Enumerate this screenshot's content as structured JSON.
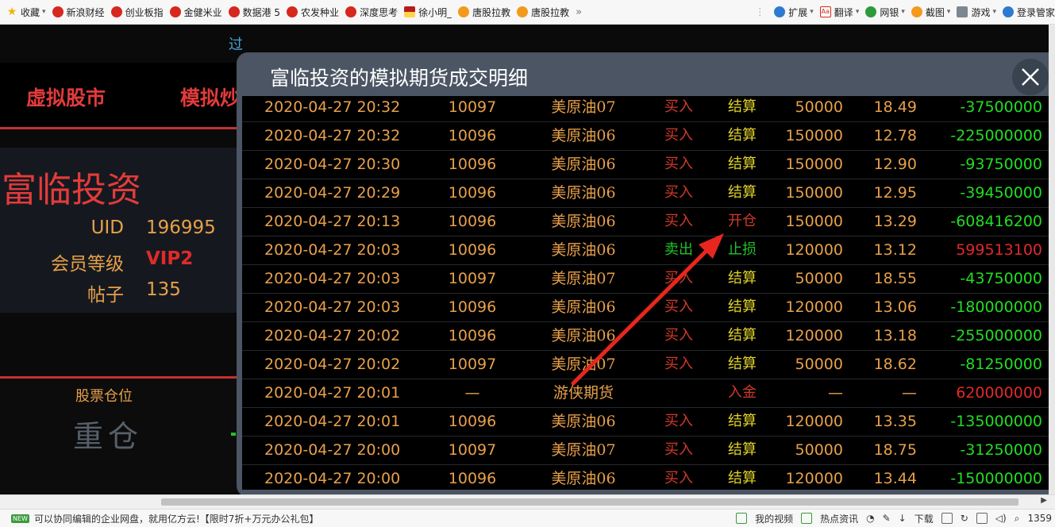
{
  "bookmarks_bar": {
    "items": [
      {
        "label": "收藏",
        "icon": "star-icon"
      },
      {
        "label": "新浪财经",
        "icon": "weibo-icon"
      },
      {
        "label": "创业板指",
        "icon": "weibo-icon"
      },
      {
        "label": "金健米业",
        "icon": "weibo-icon"
      },
      {
        "label": "数据港 5",
        "icon": "weibo-icon"
      },
      {
        "label": "农发种业",
        "icon": "weibo-icon"
      },
      {
        "label": "深度思考",
        "icon": "weibo-icon"
      },
      {
        "label": "徐小明_",
        "icon": "flag-icon"
      },
      {
        "label": "唐股拉教",
        "icon": "orange-icon"
      },
      {
        "label": "唐股拉教",
        "icon": "orange-icon"
      }
    ],
    "more": "»",
    "tools": [
      {
        "label": "扩展",
        "icon": "extensions-icon"
      },
      {
        "label": "翻译",
        "icon": "translate-icon"
      },
      {
        "label": "网银",
        "icon": "bank-icon"
      },
      {
        "label": "截图",
        "icon": "screenshot-icon"
      },
      {
        "label": "游戏",
        "icon": "game-icon"
      },
      {
        "label": "登录管家",
        "icon": "search-icon"
      }
    ]
  },
  "page": {
    "behind_text": "过",
    "nav": [
      "虚拟股市",
      "模拟炒"
    ],
    "brand": "富临投资",
    "uid_label": "UID",
    "uid_value": "196995",
    "level_label": "会员等级",
    "level_value": "VIP2",
    "posts_label": "帖子",
    "posts_value": "135",
    "position_label": "股票仓位",
    "position_value": "重仓"
  },
  "modal": {
    "title": "富临投资的模拟期货成交明细",
    "rows": [
      {
        "time": "2020-04-27 20:32",
        "code": "10097",
        "name": "美原油07",
        "side": "买入",
        "type": "结算",
        "qty": "50000",
        "price": "18.49",
        "pnl": "-37500000"
      },
      {
        "time": "2020-04-27 20:32",
        "code": "10096",
        "name": "美原油06",
        "side": "买入",
        "type": "结算",
        "qty": "150000",
        "price": "12.78",
        "pnl": "-225000000"
      },
      {
        "time": "2020-04-27 20:30",
        "code": "10096",
        "name": "美原油06",
        "side": "买入",
        "type": "结算",
        "qty": "150000",
        "price": "12.90",
        "pnl": "-93750000"
      },
      {
        "time": "2020-04-27 20:29",
        "code": "10096",
        "name": "美原油06",
        "side": "买入",
        "type": "结算",
        "qty": "150000",
        "price": "12.95",
        "pnl": "-39450000"
      },
      {
        "time": "2020-04-27 20:13",
        "code": "10096",
        "name": "美原油06",
        "side": "买入",
        "type": "开仓",
        "qty": "150000",
        "price": "13.29",
        "pnl": "-608416200"
      },
      {
        "time": "2020-04-27 20:03",
        "code": "10096",
        "name": "美原油06",
        "side": "卖出",
        "type": "止损",
        "qty": "120000",
        "price": "13.12",
        "pnl": "599513100"
      },
      {
        "time": "2020-04-27 20:03",
        "code": "10097",
        "name": "美原油07",
        "side": "买入",
        "type": "结算",
        "qty": "50000",
        "price": "18.55",
        "pnl": "-43750000"
      },
      {
        "time": "2020-04-27 20:03",
        "code": "10096",
        "name": "美原油06",
        "side": "买入",
        "type": "结算",
        "qty": "120000",
        "price": "13.06",
        "pnl": "-180000000"
      },
      {
        "time": "2020-04-27 20:02",
        "code": "10096",
        "name": "美原油06",
        "side": "买入",
        "type": "结算",
        "qty": "120000",
        "price": "13.18",
        "pnl": "-255000000"
      },
      {
        "time": "2020-04-27 20:02",
        "code": "10097",
        "name": "美原油07",
        "side": "买入",
        "type": "结算",
        "qty": "50000",
        "price": "18.62",
        "pnl": "-81250000"
      },
      {
        "time": "2020-04-27 20:01",
        "code": "—",
        "name": "游侠期货",
        "side": "",
        "type": "入金",
        "qty": "—",
        "price": "—",
        "pnl": "620000000"
      },
      {
        "time": "2020-04-27 20:01",
        "code": "10096",
        "name": "美原油06",
        "side": "买入",
        "type": "结算",
        "qty": "120000",
        "price": "13.35",
        "pnl": "-135000000"
      },
      {
        "time": "2020-04-27 20:00",
        "code": "10097",
        "name": "美原油07",
        "side": "买入",
        "type": "结算",
        "qty": "50000",
        "price": "18.75",
        "pnl": "-31250000"
      },
      {
        "time": "2020-04-27 20:00",
        "code": "10096",
        "name": "美原油06",
        "side": "买入",
        "type": "结算",
        "qty": "120000",
        "price": "13.44",
        "pnl": "-150000000"
      }
    ]
  },
  "status_bar": {
    "badge": "NEW",
    "ad_text": "可以协同编辑的企业网盘，就用亿方云!【限时7折+万元办公礼包】",
    "my_video": "我的视频",
    "hot_news": "热点资讯",
    "download": "下载",
    "zoom": "1359"
  },
  "colors": {
    "accent_orange": "#e8a04a",
    "buy_red": "#d23a2a",
    "sell_green": "#22c22a",
    "settle_yellow": "#e0d22a",
    "loss_green": "#22dd22",
    "gain_red": "#e02a2a",
    "annotation_arrow": "#e8261e"
  }
}
